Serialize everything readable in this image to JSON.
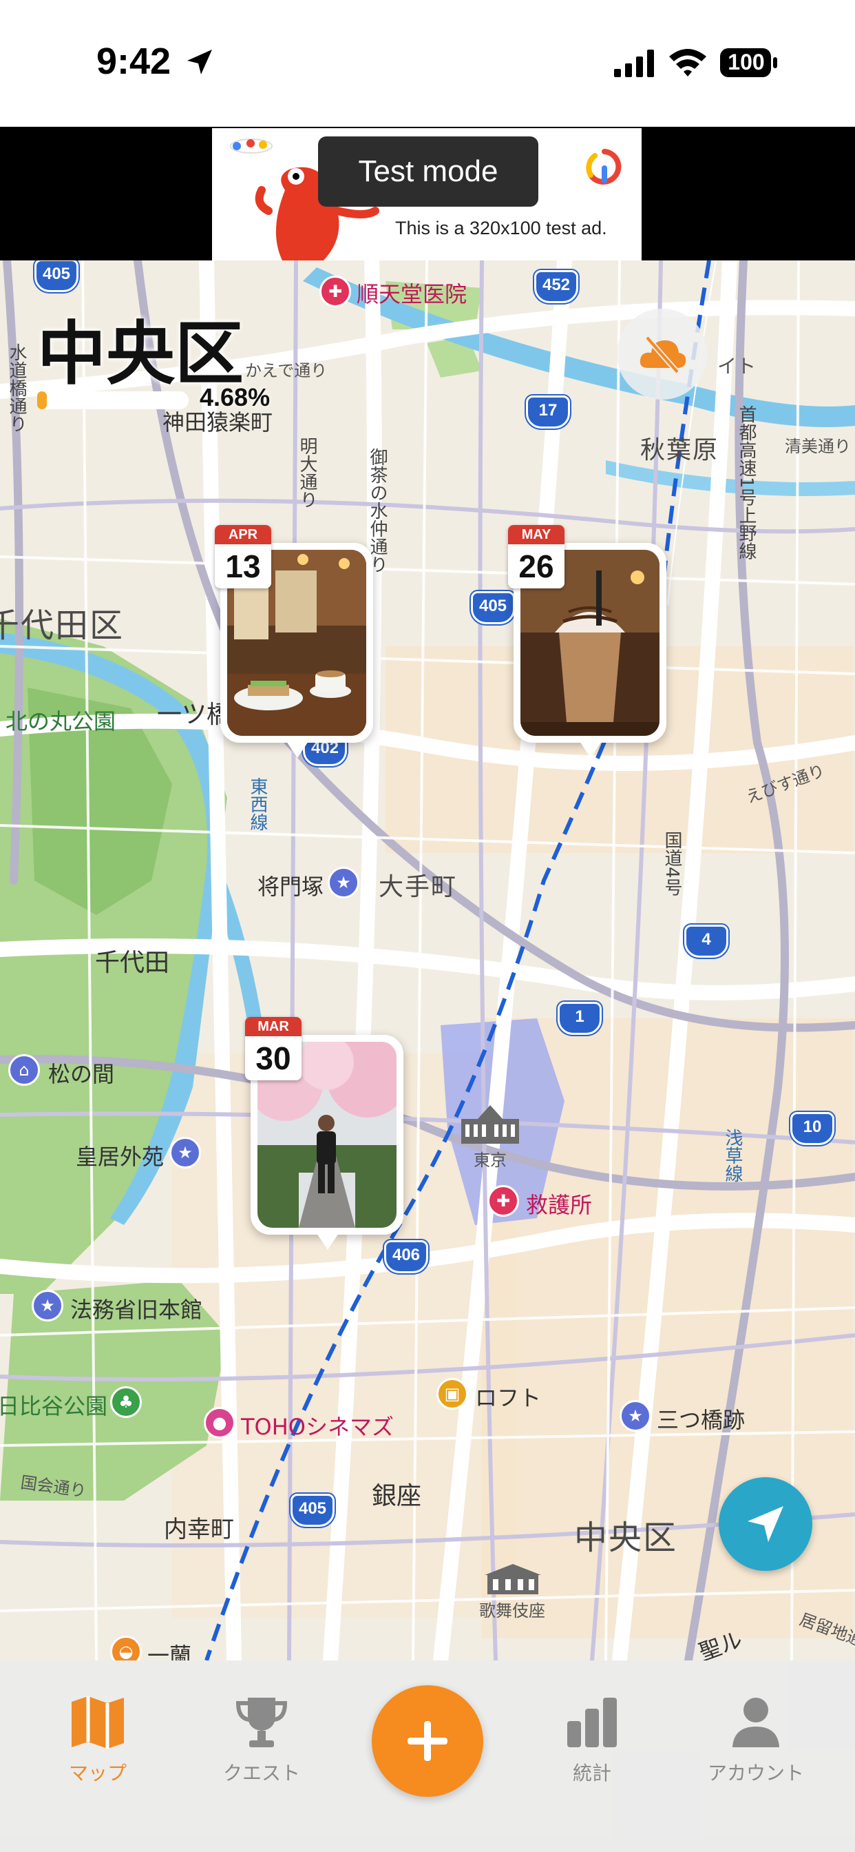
{
  "status_bar": {
    "time": "9:42",
    "battery": "100"
  },
  "ad": {
    "test_mode_label": "Test mode",
    "caption": "This is a 320x100 test ad."
  },
  "area": {
    "title": "中央区",
    "progress_text": "4.68%",
    "progress_fraction": 0.0468
  },
  "map_labels": {
    "hospital_juntendo": "順天堂医院",
    "kaede_dori": "かえで通り",
    "suidobashi_dori": "水道橋通り",
    "jimbocho": "神田猿楽町",
    "meidai_dori": "明大通り",
    "ochanomizu": "御茶の水仲通り",
    "akihabara": "秋葉原",
    "shuto_expressway": "首都高速1号上野線",
    "kiyosumi_dori": "清美通り",
    "chiyoda_ku": "千代田区",
    "kitanomaru": "北の丸公園",
    "hitotsubashi": "一ツ橋",
    "tozai_line": "東西線",
    "masakado": "将門塚",
    "otemachi": "大手町",
    "chiyoda": "千代田",
    "matsu_no_ma": "松の間",
    "kokyo_gaien": "皇居外苑",
    "tokyo_station": "東京",
    "first_aid": "救護所",
    "kokudo4": "国道4号",
    "ebisu_dori": "えびす通り",
    "asakusa_line": "浅草線",
    "homusho": "法務省旧本館",
    "hibiya_park": "日比谷公園",
    "toho_cinemas": "TOHOシネマズ",
    "loft": "ロフト",
    "mitsubashi": "三つ橋跡",
    "kokkai_dori": "国会通り",
    "uchisaiwaicho": "内幸町",
    "ginza": "銀座",
    "chuo_ku_map": "中央区",
    "kabukiza": "歌舞伎座",
    "ichiran": "一蘭",
    "kyoryuchi_dori": "居留地通り",
    "seiro": "聖ル",
    "shield_405_a": "405",
    "shield_452": "452",
    "shield_17": "17",
    "shield_405_b": "405",
    "shield_402": "402",
    "shield_4": "4",
    "shield_1": "1",
    "shield_10": "10",
    "shield_406": "406",
    "shield_405_c": "405",
    "light_fragment": "イト"
  },
  "pins": [
    {
      "month": "APR",
      "day": "13",
      "subject": "cafe"
    },
    {
      "month": "MAY",
      "day": "26",
      "subject": "frappe"
    },
    {
      "month": "MAR",
      "day": "30",
      "subject": "runner"
    }
  ],
  "tabs": [
    {
      "label": "マップ",
      "icon": "map-icon"
    },
    {
      "label": "クエスト",
      "icon": "trophy-icon"
    },
    {
      "label": "統計",
      "icon": "stats-icon"
    },
    {
      "label": "アカウント",
      "icon": "account-icon"
    }
  ],
  "colors": {
    "accent": "#f68b1f",
    "locate": "#2aa6c9",
    "calendar_red": "#d63a2f"
  }
}
